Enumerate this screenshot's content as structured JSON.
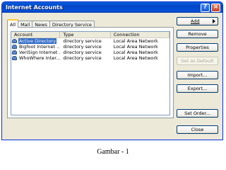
{
  "window": {
    "title": "Internet Accounts",
    "help_glyph": "?",
    "close_glyph": "×"
  },
  "tabs": [
    "All",
    "Mail",
    "News",
    "Directory Service"
  ],
  "active_tab": "All",
  "list": {
    "columns": [
      "Account",
      "Type",
      "Connection"
    ],
    "rows": [
      {
        "account": "Active Directory",
        "type": "directory service",
        "connection": "Local Area Network",
        "selected": true
      },
      {
        "account": "Bigfoot Internet ...",
        "type": "directory service",
        "connection": "Local Area Network",
        "selected": false
      },
      {
        "account": "VeriSign Internet ...",
        "type": "directory service",
        "connection": "Local Area Network",
        "selected": false
      },
      {
        "account": "WhoWhere Inter...",
        "type": "directory service",
        "connection": "Local Area Network",
        "selected": false
      }
    ]
  },
  "buttons": {
    "add": "Add",
    "remove": "Remove",
    "properties": "Properties",
    "set_default": "Set as Default",
    "import": "Import...",
    "export": "Export...",
    "set_order": "Set Order...",
    "close": "Close"
  },
  "caption": "Gambar - 1",
  "colors": {
    "titlebar": "#0a5fd8",
    "selection": "#316ac5",
    "dialog_bg": "#ece9d8"
  }
}
